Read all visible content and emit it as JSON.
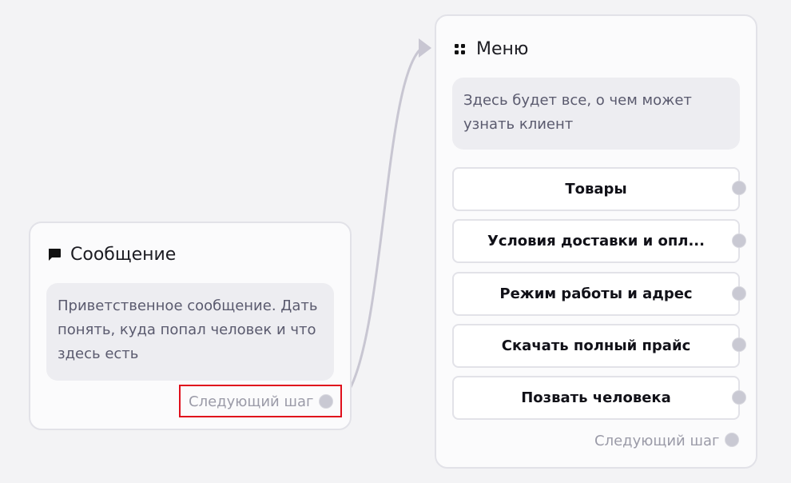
{
  "nodes": {
    "message": {
      "title": "Сообщение",
      "icon": "chat-bubble-icon",
      "description": "Приветственное сообщение. Дать понять, куда попал человек и что здесь есть",
      "next_step_label": "Следующий шаг"
    },
    "menu": {
      "title": "Меню",
      "icon": "grid-icon",
      "description": "Здесь будет все, о чем может узнать клиент",
      "options": [
        {
          "label": "Товары"
        },
        {
          "label": "Условия доставки и опл..."
        },
        {
          "label": "Режим работы и адрес"
        },
        {
          "label": "Скачать полный прайс"
        },
        {
          "label": "Позвать человека"
        }
      ],
      "next_step_label": "Следующий шаг"
    }
  },
  "colors": {
    "highlight": "#e0101c",
    "connector": "#c8c6d2",
    "handle": "#c9c9d3"
  }
}
